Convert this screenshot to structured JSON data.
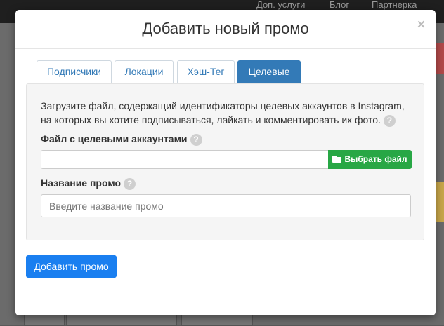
{
  "background": {
    "nav": [
      "Доп. услуги",
      "Блог",
      "Партнерка"
    ]
  },
  "modal": {
    "title": "Добавить новый промо",
    "close": "×",
    "tabs": [
      {
        "label": "Подписчики",
        "active": false
      },
      {
        "label": "Локации",
        "active": false
      },
      {
        "label": "Хэш-Тег",
        "active": false
      },
      {
        "label": "Целевые",
        "active": true
      }
    ],
    "description": "Загрузите файл, содержащий идентификаторы целевых аккаунтов в Instagram, на которых вы хотите подписываться, лайкать и комментировать их фото.",
    "help": "?",
    "file_label": "Файл с целевыми аккаунтами",
    "file_button": "Выбрать файл",
    "name_label": "Название промо",
    "name_placeholder": "Введите название промо",
    "submit": "Добавить промо"
  },
  "colors": {
    "accent": "#337ab7",
    "success": "#28a745",
    "primary": "#1a7ff0"
  },
  "icons": {
    "close": "close-icon",
    "help": "question-circle-icon",
    "folder": "folder-open-icon"
  }
}
